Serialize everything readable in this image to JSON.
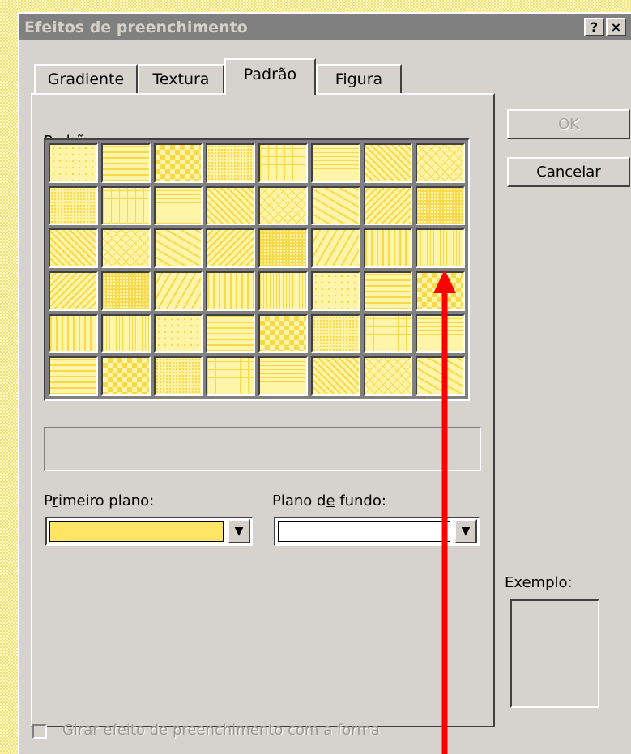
{
  "window": {
    "title": "Efeitos de preenchimento",
    "help_label": "?",
    "close_label": "×"
  },
  "tabs": [
    {
      "label": "Gradiente",
      "active": false
    },
    {
      "label": "Textura",
      "active": false
    },
    {
      "label": "Padrão",
      "active": true
    },
    {
      "label": "Figura",
      "active": false
    }
  ],
  "pattern_section": {
    "label_pre": "Pa",
    "label_key": "d",
    "label_post": "rão:",
    "rows": 6,
    "columns": 8,
    "cell_colors": {
      "background": "#fff4a8",
      "foreground": "#f7d94a"
    }
  },
  "foreground": {
    "label_pre": "P",
    "label_key": "r",
    "label_post": "imeiro plano:",
    "color": "#ffe566"
  },
  "background": {
    "label_pre": "Plano d",
    "label_key": "e",
    "label_post": " fundo:",
    "color": "#ffffff"
  },
  "buttons": {
    "ok": "OK",
    "cancel": "Cancelar"
  },
  "example": {
    "label": "Exemplo:"
  },
  "rotate_option": {
    "label": "Girar efeito de preenchimento com a forma",
    "checked": false
  },
  "annotation": {
    "arrow_color": "#ff0000"
  },
  "desktop": {
    "pattern_color": "#f2e27a"
  }
}
